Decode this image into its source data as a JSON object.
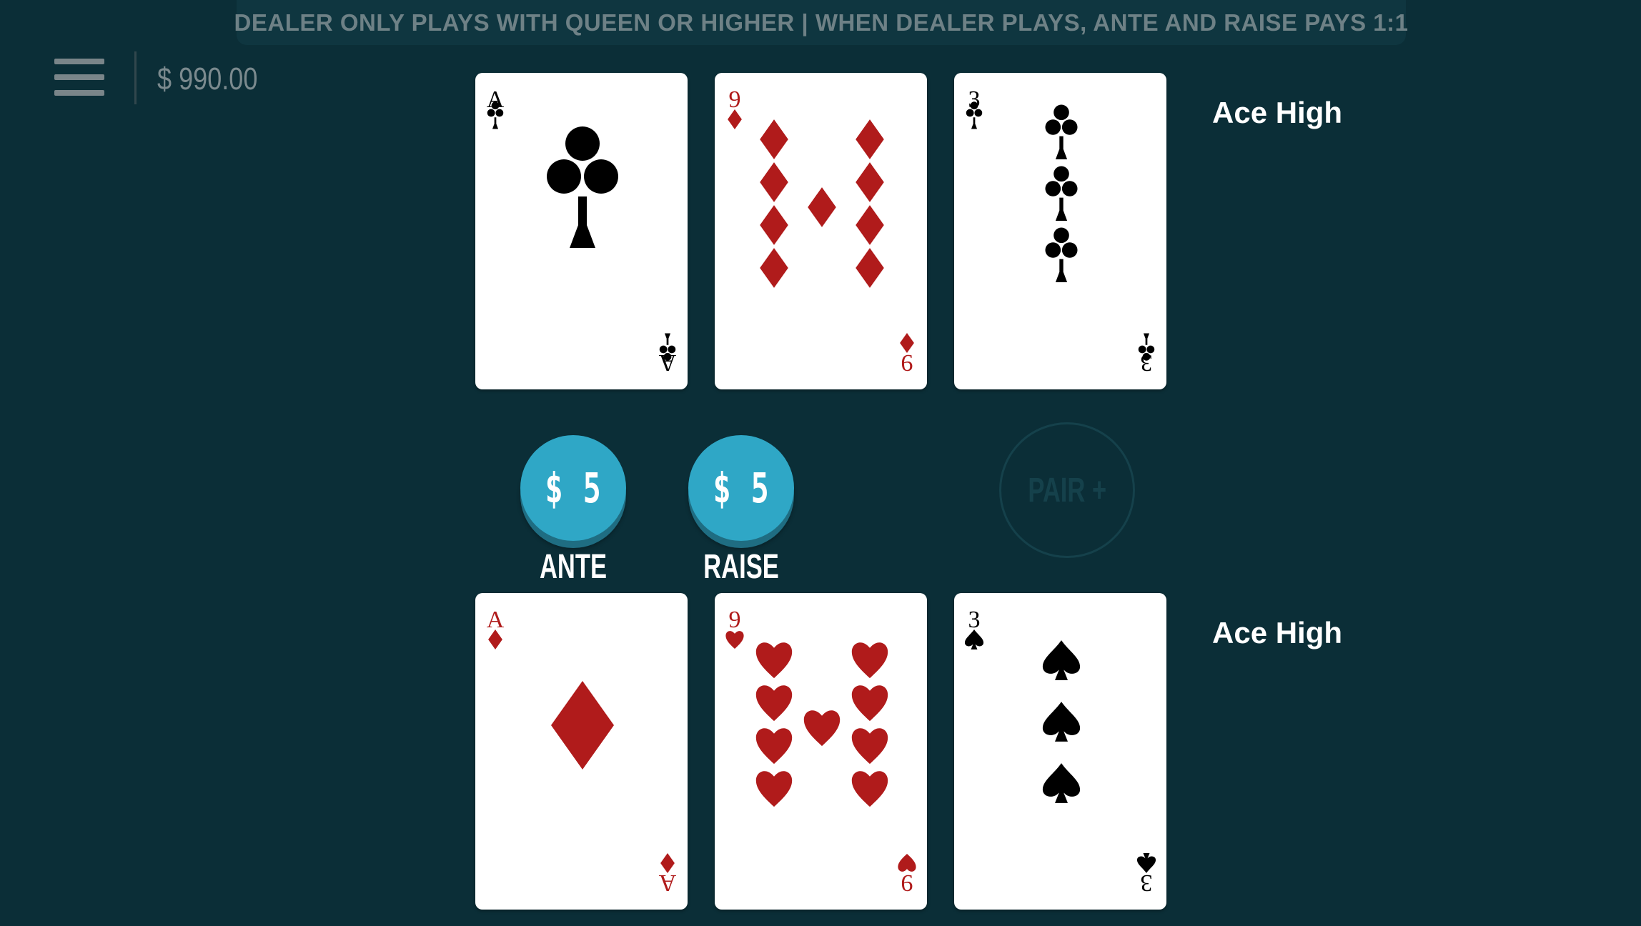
{
  "banner": {
    "text": "DEALER ONLY PLAYS WITH QUEEN OR HIGHER | WHEN DEALER PLAYS, ANTE AND RAISE PAYS 1:1"
  },
  "header": {
    "balance": "$ 990.00",
    "menu_icon": "hamburger-menu-icon"
  },
  "dealer": {
    "hand_label": "Ace High",
    "cards": [
      {
        "rank": "A",
        "suit": "clubs"
      },
      {
        "rank": "9",
        "suit": "diamonds"
      },
      {
        "rank": "3",
        "suit": "clubs"
      }
    ]
  },
  "bets": {
    "ante": {
      "amount": "$ 5",
      "label": "ANTE"
    },
    "raise": {
      "amount": "$ 5",
      "label": "RAISE"
    },
    "pair_plus": {
      "label": "PAIR +"
    }
  },
  "player": {
    "hand_label": "Ace High",
    "cards": [
      {
        "rank": "A",
        "suit": "diamonds"
      },
      {
        "rank": "9",
        "suit": "hearts"
      },
      {
        "rank": "3",
        "suit": "spades"
      }
    ]
  },
  "colors": {
    "background": "#0b2e37",
    "chip": "#2fa7c6",
    "red_suit": "#b01b1b",
    "black_suit": "#000000"
  }
}
